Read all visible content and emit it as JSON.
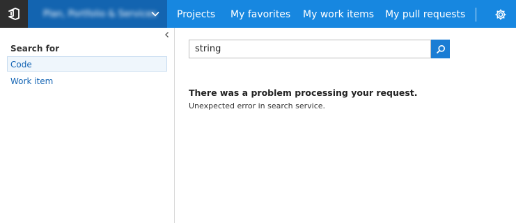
{
  "header": {
    "project_name": "Plan, Portfolio & Services",
    "nav": [
      "Projects",
      "My favorites",
      "My work items",
      "My pull requests"
    ]
  },
  "icons": {
    "logo": "vsts-logo-icon",
    "project_menu": "chevron-down-icon",
    "settings": "gear-icon",
    "collapse": "chevron-left-icon",
    "search": "search-icon"
  },
  "sidebar": {
    "heading": "Search for",
    "items": [
      {
        "label": "Code",
        "selected": true
      },
      {
        "label": "Work item",
        "selected": false
      }
    ]
  },
  "search": {
    "value": "string"
  },
  "error": {
    "title": "There was a problem processing your request.",
    "message": "Unexpected error in search service."
  },
  "colors": {
    "topbar": "#1787e0",
    "project_switch": "#1364b0",
    "logo_box": "#2e2e2e",
    "link": "#1565b4",
    "search_button": "#1a7dd4"
  }
}
